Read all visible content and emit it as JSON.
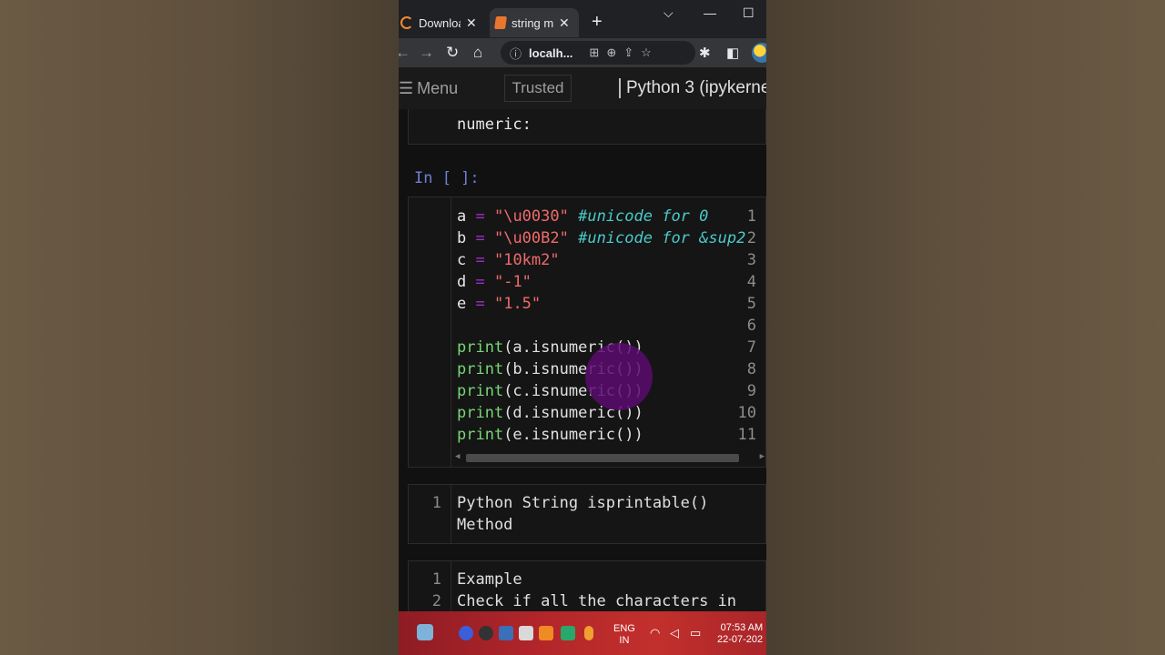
{
  "browser": {
    "tabs": [
      {
        "label": "Downloa",
        "icon": "loading-spinner-icon"
      },
      {
        "label": "string m",
        "icon": "notebook-favicon-icon"
      }
    ],
    "address": "localh..."
  },
  "jupyter": {
    "menu_label": "Menu",
    "trusted_label": "Trusted",
    "kernel_label": "Python 3 (ipykerne"
  },
  "notebook": {
    "top_markdown_text": "numeric:",
    "code_prompt": "In [ ]:",
    "line_numbers": [
      "1",
      "2",
      "3",
      "4",
      "5",
      "6",
      "7",
      "8",
      "9",
      "10",
      "11"
    ],
    "code_lines": [
      {
        "var": "a",
        "op": " = ",
        "str": "\"\\u0030\"",
        "cmt": " #unicode for 0"
      },
      {
        "var": "b",
        "op": " = ",
        "str": "\"\\u00B2\"",
        "cmt": " #unicode for &sup2"
      },
      {
        "var": "c",
        "op": " = ",
        "str": "\"10km2\"",
        "cmt": ""
      },
      {
        "var": "d",
        "op": " = ",
        "str": "\"-1\"",
        "cmt": ""
      },
      {
        "var": "e",
        "op": " = ",
        "str": "\"1.5\"",
        "cmt": ""
      },
      {
        "var": "",
        "op": "",
        "str": "",
        "cmt": ""
      },
      {
        "kw": "print",
        "rest": "(a.isnumeric())"
      },
      {
        "kw": "print",
        "rest": "(b.isnumeric())"
      },
      {
        "kw": "print",
        "rest": "(c.isnumeric())"
      },
      {
        "kw": "print",
        "rest": "(d.isnumeric())"
      },
      {
        "kw": "print",
        "rest": "(e.isnumeric())"
      }
    ],
    "md_cell_1": {
      "num": "1",
      "line1": "Python String isprintable()",
      "line2": "Method"
    },
    "md_cell_2": {
      "num1": "1",
      "num2": "2",
      "line1": "Example",
      "line2": "Check if all the characters in"
    }
  },
  "taskbar": {
    "lang_line1": "ENG",
    "lang_line2": "IN",
    "time": "07:53 AM",
    "date": "22-07-202"
  },
  "colors": {
    "prompt": "#6f7fd6",
    "string": "#ef6a6a",
    "comment": "#4ac9c9",
    "keyword": "#77d677",
    "operator": "#9e2fc0"
  }
}
